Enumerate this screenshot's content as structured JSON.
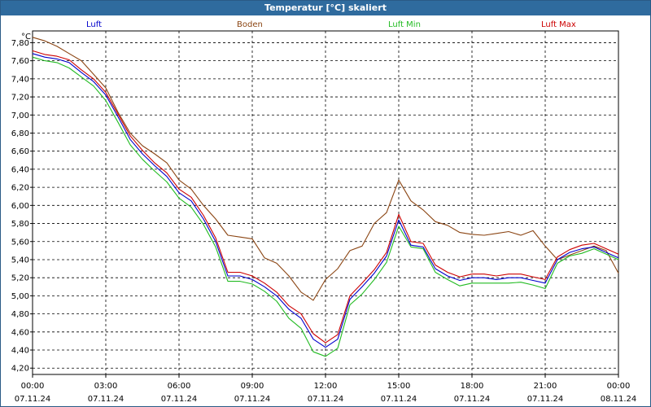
{
  "chart_data": {
    "type": "line",
    "title": "Temperatur [°C] skaliert",
    "ylabel": "°C",
    "xlabel": "",
    "ylim": [
      4.13,
      7.93
    ],
    "y_ticks": [
      "7,80",
      "7,60",
      "7,40",
      "7,20",
      "7,00",
      "6,80",
      "6,60",
      "6,40",
      "6,20",
      "6,00",
      "5,80",
      "5,60",
      "5,40",
      "5,20",
      "5,00",
      "4,80",
      "4,60",
      "4,40",
      "4,20"
    ],
    "x_range_hours": [
      0,
      24
    ],
    "x_ticks": [
      {
        "time": "00:00",
        "date": "07.11.24"
      },
      {
        "time": "03:00",
        "date": "07.11.24"
      },
      {
        "time": "06:00",
        "date": "07.11.24"
      },
      {
        "time": "09:00",
        "date": "07.11.24"
      },
      {
        "time": "12:00",
        "date": "07.11.24"
      },
      {
        "time": "15:00",
        "date": "07.11.24"
      },
      {
        "time": "18:00",
        "date": "07.11.24"
      },
      {
        "time": "21:00",
        "date": "07.11.24"
      },
      {
        "time": "00:00",
        "date": "08.11.24"
      }
    ],
    "grid": true,
    "legend": "top",
    "x": [
      0.0,
      0.5,
      1.0,
      1.5,
      2.0,
      2.5,
      3.0,
      3.5,
      4.0,
      4.5,
      5.0,
      5.5,
      6.0,
      6.5,
      7.0,
      7.5,
      8.0,
      8.5,
      9.0,
      9.5,
      10.0,
      10.5,
      11.0,
      11.5,
      12.0,
      12.5,
      13.0,
      13.5,
      14.0,
      14.5,
      15.0,
      15.5,
      16.0,
      16.5,
      17.0,
      17.5,
      18.0,
      18.5,
      19.0,
      19.5,
      20.0,
      20.5,
      21.0,
      21.5,
      22.0,
      22.5,
      23.0,
      23.5,
      24.0
    ],
    "series": [
      {
        "name": "Luft",
        "color": "#0000cc",
        "values": [
          7.68,
          7.64,
          7.62,
          7.58,
          7.47,
          7.37,
          7.22,
          6.98,
          6.73,
          6.57,
          6.44,
          6.32,
          6.14,
          6.05,
          5.85,
          5.6,
          5.22,
          5.22,
          5.18,
          5.1,
          5.0,
          4.85,
          4.75,
          4.52,
          4.43,
          4.52,
          4.96,
          5.1,
          5.25,
          5.44,
          5.84,
          5.56,
          5.54,
          5.3,
          5.22,
          5.17,
          5.2,
          5.2,
          5.18,
          5.2,
          5.2,
          5.17,
          5.14,
          5.4,
          5.48,
          5.52,
          5.54,
          5.48,
          5.42
        ]
      },
      {
        "name": "Boden",
        "color": "#8b4513",
        "values": [
          7.86,
          7.82,
          7.76,
          7.68,
          7.6,
          7.45,
          7.3,
          7.03,
          6.8,
          6.66,
          6.57,
          6.47,
          6.28,
          6.18,
          6.0,
          5.85,
          5.67,
          5.65,
          5.63,
          5.42,
          5.36,
          5.22,
          5.04,
          4.95,
          5.18,
          5.3,
          5.5,
          5.55,
          5.8,
          5.92,
          6.28,
          6.05,
          5.95,
          5.82,
          5.78,
          5.7,
          5.68,
          5.67,
          5.69,
          5.71,
          5.67,
          5.72,
          5.55,
          5.4,
          5.45,
          5.5,
          5.55,
          5.5,
          5.25
        ]
      },
      {
        "name": "Luft Min",
        "color": "#22bb22",
        "values": [
          7.64,
          7.6,
          7.58,
          7.52,
          7.42,
          7.32,
          7.16,
          6.92,
          6.67,
          6.51,
          6.38,
          6.26,
          6.08,
          5.98,
          5.79,
          5.54,
          5.16,
          5.16,
          5.13,
          5.05,
          4.94,
          4.75,
          4.64,
          4.38,
          4.33,
          4.42,
          4.9,
          5.02,
          5.18,
          5.37,
          5.77,
          5.54,
          5.52,
          5.26,
          5.18,
          5.11,
          5.14,
          5.14,
          5.14,
          5.14,
          5.15,
          5.12,
          5.08,
          5.36,
          5.44,
          5.47,
          5.52,
          5.46,
          5.4
        ]
      },
      {
        "name": "Luft Max",
        "color": "#cc0000",
        "values": [
          7.71,
          7.67,
          7.65,
          7.61,
          7.5,
          7.4,
          7.25,
          7.01,
          6.77,
          6.61,
          6.47,
          6.36,
          6.18,
          6.09,
          5.89,
          5.64,
          5.26,
          5.26,
          5.22,
          5.14,
          5.04,
          4.89,
          4.8,
          4.58,
          4.48,
          4.57,
          5.0,
          5.14,
          5.29,
          5.48,
          5.9,
          5.6,
          5.58,
          5.34,
          5.26,
          5.21,
          5.24,
          5.24,
          5.22,
          5.24,
          5.24,
          5.21,
          5.18,
          5.43,
          5.51,
          5.56,
          5.58,
          5.52,
          5.46
        ]
      }
    ]
  }
}
